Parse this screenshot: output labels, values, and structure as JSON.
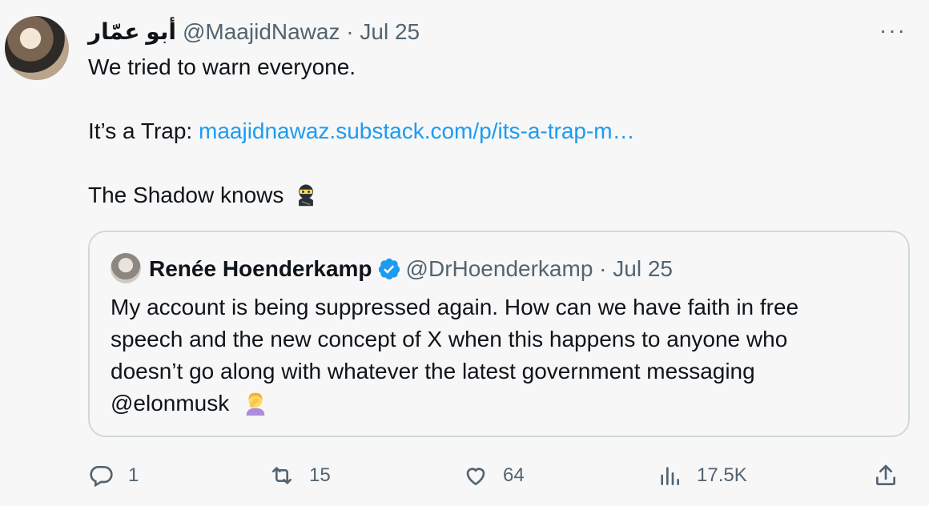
{
  "tweet": {
    "display_name": "أبو عمّار",
    "handle": "@MaajidNawaz",
    "separator": "·",
    "date": "Jul 25",
    "more_label": "···",
    "line1": "We tried to warn everyone.",
    "line2_prefix": "It’s a Trap: ",
    "link_text": "maajidnawaz.substack.com/p/its-a-trap-m…",
    "line3": "The Shadow knows"
  },
  "quote": {
    "display_name": "Renée Hoenderkamp",
    "handle": "@DrHoenderkamp",
    "separator": "·",
    "date": "Jul 25",
    "text_line1": "My account is being suppressed again. How can we have faith in free",
    "text_line2": "speech and the new concept of X when this happens to anyone who",
    "text_line3": "doesn’t go along with whatever the latest government messaging",
    "mention": "@elonmusk"
  },
  "actions": {
    "replies": "1",
    "reposts": "15",
    "likes": "64",
    "views": "17.5K"
  },
  "colors": {
    "link": "#1d9bf0",
    "muted": "#536471",
    "border": "#cfd9de",
    "verified": "#1d9bf0"
  }
}
